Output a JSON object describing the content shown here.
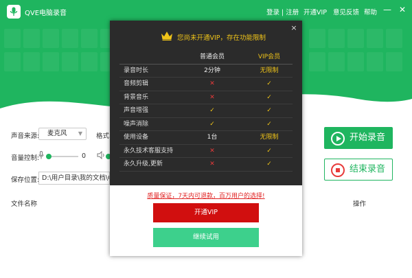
{
  "app": {
    "title": "QVE电脑录音"
  },
  "topnav": {
    "login": "登录 | 注册",
    "vip": "开通VIP",
    "feedback": "意见反馈",
    "help": "帮助"
  },
  "window": {
    "minimize_icon": "minimize-icon",
    "close_icon": "close-icon"
  },
  "controls": {
    "source_label": "声音来源:",
    "source_value": "麦克风",
    "format_label": "格式:",
    "volume_label": "音量控制:",
    "mic_volume": "0",
    "mic_volume_level": 0,
    "speaker_volume_level": 0,
    "save_label": "保存位置:",
    "save_path": "D:\\用户目录\\我的文档\\QVE"
  },
  "buttons": {
    "start": "开始录音",
    "stop": "结束录音"
  },
  "table": {
    "col_name": "文件名称",
    "col_action": "操作"
  },
  "modal": {
    "title": "您尚未开通VIP，存在功能限制",
    "close": "×",
    "col_basic": "普通会员",
    "col_vip": "VIP会员",
    "rows": [
      {
        "feature": "录音时长",
        "basic": "2分钟",
        "vip": "无限制"
      },
      {
        "feature": "音频剪辑",
        "basic": "✕",
        "vip": "✓"
      },
      {
        "feature": "背景音乐",
        "basic": "✕",
        "vip": "✓"
      },
      {
        "feature": "声音增强",
        "basic": "✓",
        "vip": "✓"
      },
      {
        "feature": "噪声消除",
        "basic": "✓",
        "vip": "✓"
      },
      {
        "feature": "使用设备",
        "basic": "1台",
        "vip": "无限制"
      },
      {
        "feature": "永久技术客服支持",
        "basic": "✕",
        "vip": "✓"
      },
      {
        "feature": "永久升级,更新",
        "basic": "✕",
        "vip": "✓"
      }
    ],
    "guarantee": "质量保证，7天内可退款，百万用户的选择!",
    "vip_button": "开通VIP",
    "trial_button": "继续试用"
  },
  "colors": {
    "brand_green": "#1fb55f",
    "vip_red": "#d10f0f",
    "trial_green": "#3dd08c",
    "gold": "#f0c419",
    "cross_red": "#e83a3a"
  }
}
